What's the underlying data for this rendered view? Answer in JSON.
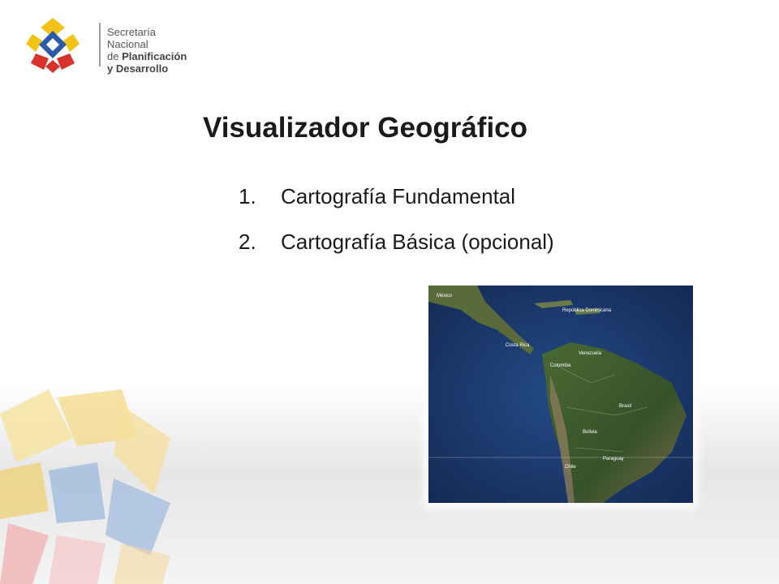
{
  "logo": {
    "line1": "Secretaría Nacional",
    "line2_prefix": "de ",
    "line2_bold": "Planificación",
    "line3": "y Desarrollo"
  },
  "slide": {
    "title": "Visualizador Geográfico",
    "items": [
      {
        "number": "1.",
        "label": "Cartografía Fundamental"
      },
      {
        "number": "2.",
        "label": "Cartografía Básica (opcional)"
      }
    ]
  },
  "map": {
    "labels": [
      "México",
      "Colombia",
      "Venezuela",
      "Brasil",
      "Bolivia",
      "Paraguay",
      "Chile",
      "Costa Rica",
      "República Dominicana"
    ]
  },
  "colors": {
    "yellow": "#f2c316",
    "blue": "#2a5aa8",
    "red": "#d8332a",
    "ocean": "#1e3a6e",
    "land": "#3d5a2a"
  }
}
